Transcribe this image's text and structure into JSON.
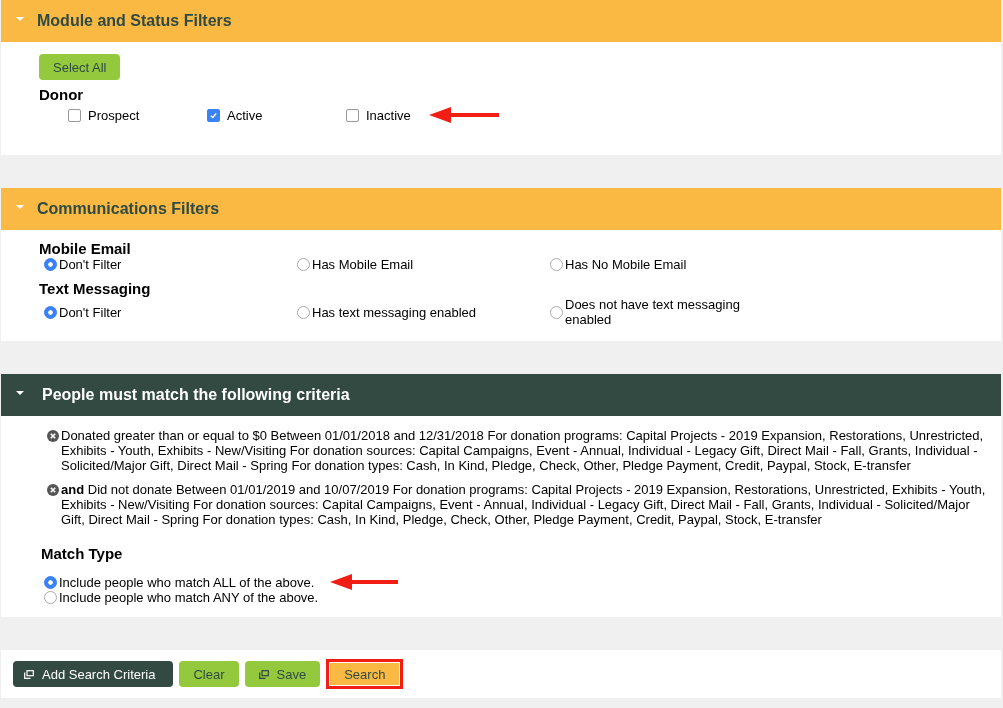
{
  "module_filters": {
    "title": "Module and Status Filters",
    "select_all": "Select All",
    "group": "Donor",
    "options": [
      {
        "label": "Prospect",
        "checked": false
      },
      {
        "label": "Active",
        "checked": true
      },
      {
        "label": "Inactive",
        "checked": false
      }
    ]
  },
  "communications": {
    "title": "Communications Filters",
    "groups": [
      {
        "label": "Mobile Email",
        "options": [
          {
            "label": "Don't Filter",
            "selected": true
          },
          {
            "label": "Has Mobile Email",
            "selected": false
          },
          {
            "label": "Has No Mobile Email",
            "selected": false
          }
        ]
      },
      {
        "label": "Text Messaging",
        "options": [
          {
            "label": "Don't Filter",
            "selected": true
          },
          {
            "label": "Has text messaging enabled",
            "selected": false
          },
          {
            "label": "Does not have text messaging enabled",
            "selected": false
          }
        ]
      }
    ]
  },
  "criteria": {
    "title": "People must match the following criteria",
    "items": [
      "Donated greater than or equal to $0 Between 01/01/2018 and 12/31/2018 For donation programs: Capital Projects - 2019 Expansion, Restorations, Unrestricted, Exhibits - Youth, Exhibits - New/Visiting For donation sources: Capital Campaigns, Event - Annual, Individual - Legacy Gift, Direct Mail - Fall, Grants, Individual - Solicited/Major Gift, Direct Mail - Spring For donation types: Cash, In Kind, Pledge, Check, Other, Pledge Payment, Credit, Paypal, Stock, E-transfer",
      "**and** Did not donate Between 01/01/2019 and 10/07/2019 For donation programs: Capital Projects - 2019 Expansion, Restorations, Unrestricted, Exhibits - Youth, Exhibits - New/Visiting For donation sources: Capital Campaigns, Event - Annual, Individual - Legacy Gift, Direct Mail - Fall, Grants, Individual - Solicited/Major Gift, Direct Mail - Spring For donation types: Cash, In Kind, Pledge, Check, Other, Pledge Payment, Credit, Paypal, Stock, E-transfer"
    ],
    "match_type": {
      "label": "Match Type",
      "options": [
        {
          "label": "Include people who match ALL of the above.",
          "selected": true
        },
        {
          "label": "Include people who match ANY of the above.",
          "selected": false
        }
      ]
    }
  },
  "buttons": [
    {
      "label": "Add Search Criteria",
      "kind": "dark",
      "icon": true,
      "highlighted": false
    },
    {
      "label": "Clear",
      "kind": "green",
      "icon": false,
      "highlighted": false
    },
    {
      "label": "Save",
      "kind": "green",
      "icon": true,
      "highlighted": false
    },
    {
      "label": "Search",
      "kind": "orange",
      "icon": false,
      "highlighted": true
    }
  ]
}
